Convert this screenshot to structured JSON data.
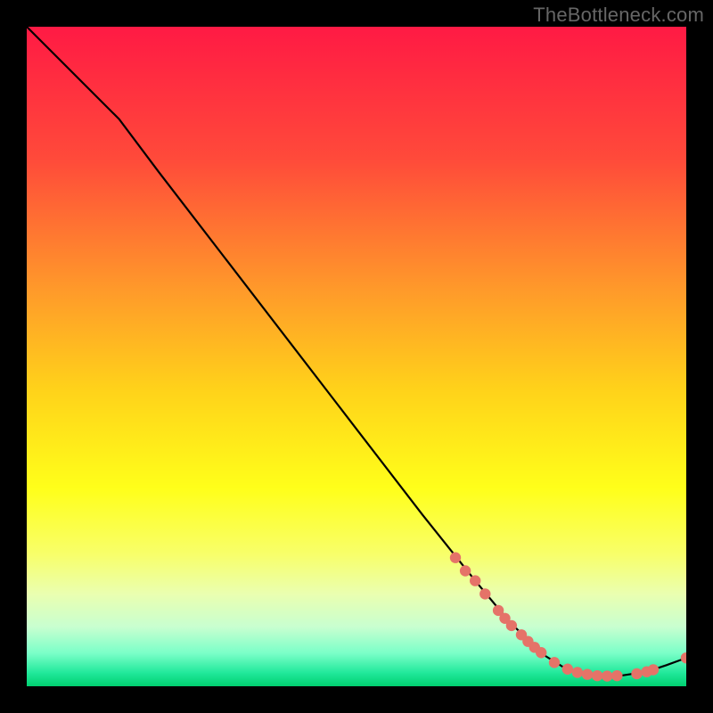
{
  "watermark": "TheBottleneck.com",
  "chart_data": {
    "type": "line",
    "title": "",
    "xlabel": "",
    "ylabel": "",
    "xlim": [
      0,
      100
    ],
    "ylim": [
      0,
      100
    ],
    "gradient_stops": [
      {
        "offset": 0,
        "color": "#ff1a44"
      },
      {
        "offset": 20,
        "color": "#ff4a3a"
      },
      {
        "offset": 40,
        "color": "#ff9a2a"
      },
      {
        "offset": 55,
        "color": "#ffd21a"
      },
      {
        "offset": 70,
        "color": "#ffff1a"
      },
      {
        "offset": 80,
        "color": "#f8ff6a"
      },
      {
        "offset": 86,
        "color": "#eaffb0"
      },
      {
        "offset": 91,
        "color": "#c8ffd0"
      },
      {
        "offset": 95,
        "color": "#7affc8"
      },
      {
        "offset": 98,
        "color": "#20e89a"
      },
      {
        "offset": 100,
        "color": "#00d070"
      }
    ],
    "curve": [
      {
        "x": 0,
        "y": 100
      },
      {
        "x": 5,
        "y": 95
      },
      {
        "x": 9,
        "y": 91
      },
      {
        "x": 14,
        "y": 86
      },
      {
        "x": 20,
        "y": 78
      },
      {
        "x": 30,
        "y": 65
      },
      {
        "x": 40,
        "y": 52
      },
      {
        "x": 50,
        "y": 39
      },
      {
        "x": 60,
        "y": 26
      },
      {
        "x": 68,
        "y": 16
      },
      {
        "x": 73,
        "y": 10
      },
      {
        "x": 78,
        "y": 5
      },
      {
        "x": 82,
        "y": 2.5
      },
      {
        "x": 86,
        "y": 1.5
      },
      {
        "x": 90,
        "y": 1.6
      },
      {
        "x": 94,
        "y": 2.2
      },
      {
        "x": 97,
        "y": 3.2
      },
      {
        "x": 100,
        "y": 4.3
      }
    ],
    "markers": [
      {
        "x": 65,
        "y": 19.5
      },
      {
        "x": 66.5,
        "y": 17.5
      },
      {
        "x": 68,
        "y": 16
      },
      {
        "x": 69.5,
        "y": 14
      },
      {
        "x": 71.5,
        "y": 11.5
      },
      {
        "x": 72.5,
        "y": 10.3
      },
      {
        "x": 73.5,
        "y": 9.2
      },
      {
        "x": 75,
        "y": 7.8
      },
      {
        "x": 76,
        "y": 6.8
      },
      {
        "x": 77,
        "y": 5.9
      },
      {
        "x": 78,
        "y": 5.1
      },
      {
        "x": 80,
        "y": 3.6
      },
      {
        "x": 82,
        "y": 2.6
      },
      {
        "x": 83.5,
        "y": 2.1
      },
      {
        "x": 85,
        "y": 1.8
      },
      {
        "x": 86.5,
        "y": 1.6
      },
      {
        "x": 88,
        "y": 1.55
      },
      {
        "x": 89.5,
        "y": 1.6
      },
      {
        "x": 92.5,
        "y": 1.9
      },
      {
        "x": 94,
        "y": 2.2
      },
      {
        "x": 95,
        "y": 2.5
      },
      {
        "x": 100,
        "y": 4.3
      }
    ],
    "marker_color": "#e57368",
    "curve_color": "#000000"
  }
}
